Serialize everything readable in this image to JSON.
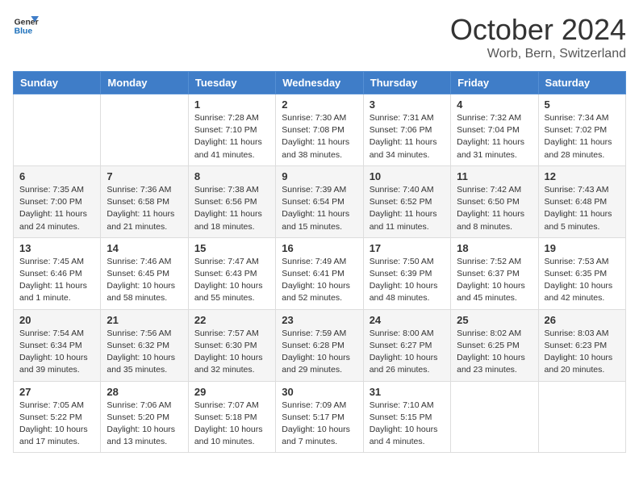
{
  "logo": {
    "line1": "General",
    "line2": "Blue"
  },
  "title": "October 2024",
  "location": "Worb, Bern, Switzerland",
  "days_of_week": [
    "Sunday",
    "Monday",
    "Tuesday",
    "Wednesday",
    "Thursday",
    "Friday",
    "Saturday"
  ],
  "weeks": [
    [
      {
        "day": null,
        "info": null
      },
      {
        "day": null,
        "info": null
      },
      {
        "day": "1",
        "info": "Sunrise: 7:28 AM\nSunset: 7:10 PM\nDaylight: 11 hours and 41 minutes."
      },
      {
        "day": "2",
        "info": "Sunrise: 7:30 AM\nSunset: 7:08 PM\nDaylight: 11 hours and 38 minutes."
      },
      {
        "day": "3",
        "info": "Sunrise: 7:31 AM\nSunset: 7:06 PM\nDaylight: 11 hours and 34 minutes."
      },
      {
        "day": "4",
        "info": "Sunrise: 7:32 AM\nSunset: 7:04 PM\nDaylight: 11 hours and 31 minutes."
      },
      {
        "day": "5",
        "info": "Sunrise: 7:34 AM\nSunset: 7:02 PM\nDaylight: 11 hours and 28 minutes."
      }
    ],
    [
      {
        "day": "6",
        "info": "Sunrise: 7:35 AM\nSunset: 7:00 PM\nDaylight: 11 hours and 24 minutes."
      },
      {
        "day": "7",
        "info": "Sunrise: 7:36 AM\nSunset: 6:58 PM\nDaylight: 11 hours and 21 minutes."
      },
      {
        "day": "8",
        "info": "Sunrise: 7:38 AM\nSunset: 6:56 PM\nDaylight: 11 hours and 18 minutes."
      },
      {
        "day": "9",
        "info": "Sunrise: 7:39 AM\nSunset: 6:54 PM\nDaylight: 11 hours and 15 minutes."
      },
      {
        "day": "10",
        "info": "Sunrise: 7:40 AM\nSunset: 6:52 PM\nDaylight: 11 hours and 11 minutes."
      },
      {
        "day": "11",
        "info": "Sunrise: 7:42 AM\nSunset: 6:50 PM\nDaylight: 11 hours and 8 minutes."
      },
      {
        "day": "12",
        "info": "Sunrise: 7:43 AM\nSunset: 6:48 PM\nDaylight: 11 hours and 5 minutes."
      }
    ],
    [
      {
        "day": "13",
        "info": "Sunrise: 7:45 AM\nSunset: 6:46 PM\nDaylight: 11 hours and 1 minute."
      },
      {
        "day": "14",
        "info": "Sunrise: 7:46 AM\nSunset: 6:45 PM\nDaylight: 10 hours and 58 minutes."
      },
      {
        "day": "15",
        "info": "Sunrise: 7:47 AM\nSunset: 6:43 PM\nDaylight: 10 hours and 55 minutes."
      },
      {
        "day": "16",
        "info": "Sunrise: 7:49 AM\nSunset: 6:41 PM\nDaylight: 10 hours and 52 minutes."
      },
      {
        "day": "17",
        "info": "Sunrise: 7:50 AM\nSunset: 6:39 PM\nDaylight: 10 hours and 48 minutes."
      },
      {
        "day": "18",
        "info": "Sunrise: 7:52 AM\nSunset: 6:37 PM\nDaylight: 10 hours and 45 minutes."
      },
      {
        "day": "19",
        "info": "Sunrise: 7:53 AM\nSunset: 6:35 PM\nDaylight: 10 hours and 42 minutes."
      }
    ],
    [
      {
        "day": "20",
        "info": "Sunrise: 7:54 AM\nSunset: 6:34 PM\nDaylight: 10 hours and 39 minutes."
      },
      {
        "day": "21",
        "info": "Sunrise: 7:56 AM\nSunset: 6:32 PM\nDaylight: 10 hours and 35 minutes."
      },
      {
        "day": "22",
        "info": "Sunrise: 7:57 AM\nSunset: 6:30 PM\nDaylight: 10 hours and 32 minutes."
      },
      {
        "day": "23",
        "info": "Sunrise: 7:59 AM\nSunset: 6:28 PM\nDaylight: 10 hours and 29 minutes."
      },
      {
        "day": "24",
        "info": "Sunrise: 8:00 AM\nSunset: 6:27 PM\nDaylight: 10 hours and 26 minutes."
      },
      {
        "day": "25",
        "info": "Sunrise: 8:02 AM\nSunset: 6:25 PM\nDaylight: 10 hours and 23 minutes."
      },
      {
        "day": "26",
        "info": "Sunrise: 8:03 AM\nSunset: 6:23 PM\nDaylight: 10 hours and 20 minutes."
      }
    ],
    [
      {
        "day": "27",
        "info": "Sunrise: 7:05 AM\nSunset: 5:22 PM\nDaylight: 10 hours and 17 minutes."
      },
      {
        "day": "28",
        "info": "Sunrise: 7:06 AM\nSunset: 5:20 PM\nDaylight: 10 hours and 13 minutes."
      },
      {
        "day": "29",
        "info": "Sunrise: 7:07 AM\nSunset: 5:18 PM\nDaylight: 10 hours and 10 minutes."
      },
      {
        "day": "30",
        "info": "Sunrise: 7:09 AM\nSunset: 5:17 PM\nDaylight: 10 hours and 7 minutes."
      },
      {
        "day": "31",
        "info": "Sunrise: 7:10 AM\nSunset: 5:15 PM\nDaylight: 10 hours and 4 minutes."
      },
      {
        "day": null,
        "info": null
      },
      {
        "day": null,
        "info": null
      }
    ]
  ]
}
